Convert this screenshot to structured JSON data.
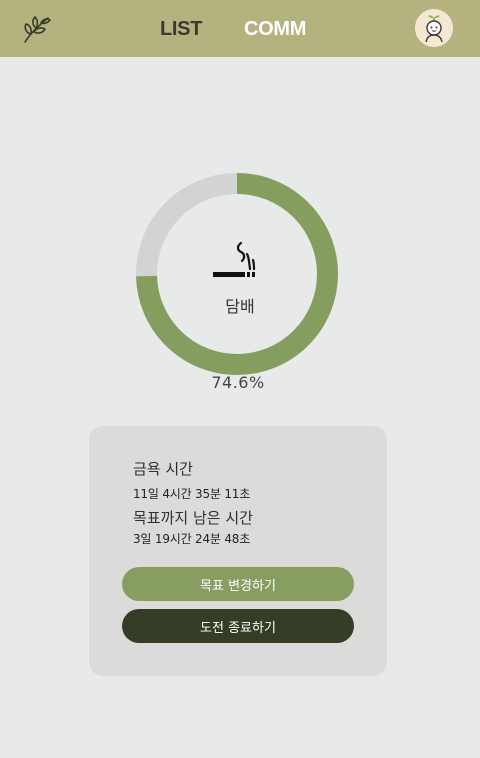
{
  "nav": {
    "list_label": "LIST",
    "comm_label": "COMM",
    "logo_icon": "leaf-branch-icon",
    "avatar_icon": "sprout-avatar-icon"
  },
  "progress": {
    "label": "담배",
    "icon": "cigarette-icon",
    "percent_text": "74.6%",
    "fraction": 0.746,
    "fill_color": "#869d60",
    "track_color": "#d2d4d3"
  },
  "stats": {
    "abstain_title": "금욕 시간",
    "abstain_value": "11일 4시간 35분 11초",
    "remaining_title": "목표까지 남은 시간",
    "remaining_value": "3일 19시간 24분 48초"
  },
  "buttons": {
    "change_goal": "목표 변경하기",
    "end_challenge": "도전 종료하기"
  },
  "colors": {
    "header": "#b4b27f",
    "background": "#e8eae9",
    "card": "#dddbda",
    "primary_button": "#879d61",
    "dark_button": "#343e26"
  }
}
